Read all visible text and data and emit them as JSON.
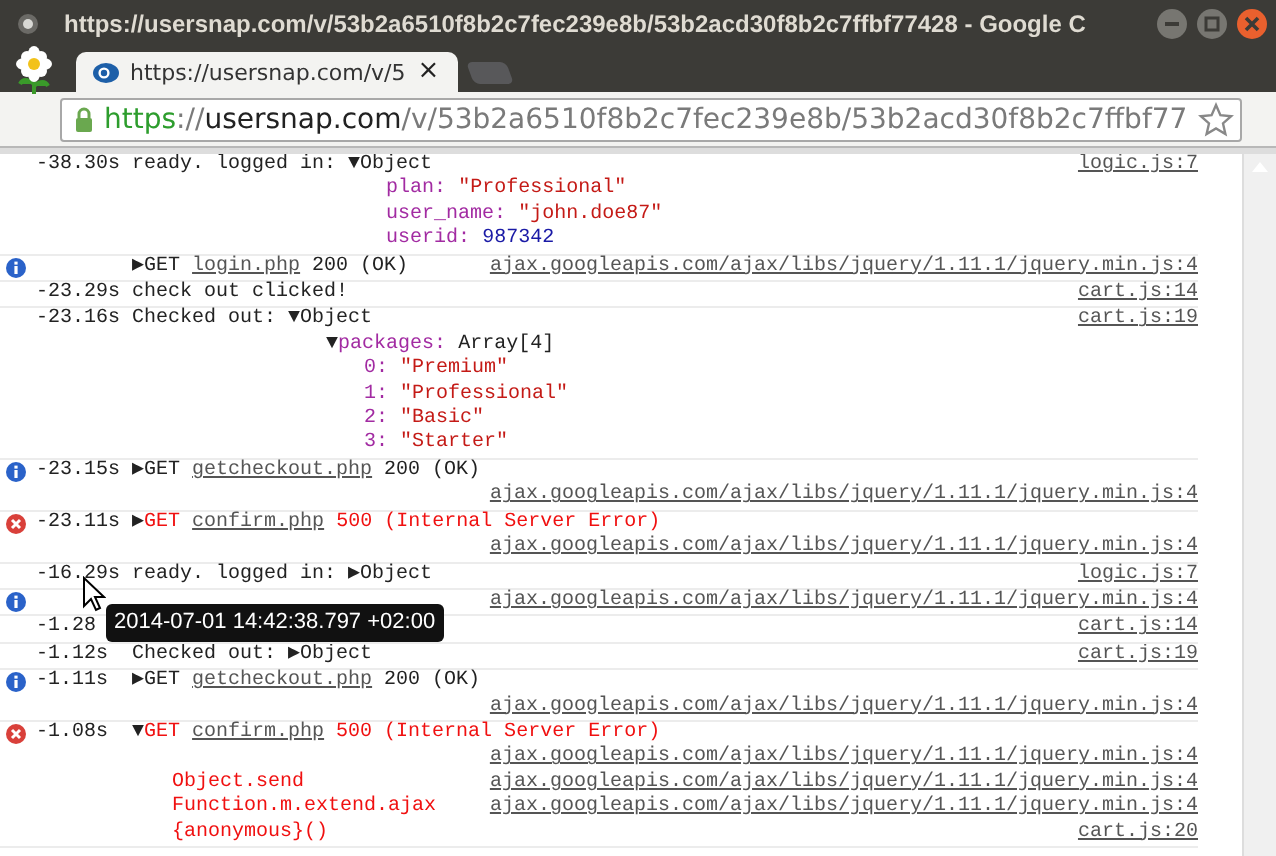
{
  "window": {
    "title": "https://usersnap.com/v/53b2a6510f8b2c7fec239e8b/53b2acd30f8b2c7ffbf77428 - Google C"
  },
  "tabs": [
    {
      "title": "https://usersnap.com/v/5",
      "selected": true,
      "close": "×"
    }
  ],
  "address_bar": [
    {
      "text": "https",
      "kind": "secure"
    },
    {
      "text": "://",
      "kind": "dim"
    },
    {
      "text": "usersnap.com",
      "kind": "host"
    },
    {
      "text": "/v/53b2a6510f8b2c7fec239e8b/53b2acd30f8b2c7ffbf77",
      "kind": "dim"
    }
  ],
  "console": [
    {
      "kind": "log",
      "time": "-38.30s",
      "message": [
        {
          "text": "ready. logged in: ",
          "kind": "plain"
        }
      ],
      "tree": {
        "toggle": "▼",
        "label": "Object",
        "children": [
          {
            "key": "plan:",
            "value": "\"Professional\"",
            "kind": "string"
          },
          {
            "key": "user_name:",
            "value": "\"john.doe87\"",
            "kind": "string"
          },
          {
            "key": "userid:",
            "value": "987342",
            "kind": "number"
          }
        ]
      },
      "source": "logic.js:7",
      "source_below": false
    },
    {
      "kind": "info",
      "message": [
        {
          "text": "▶GET ",
          "kind": "plain"
        },
        {
          "text": "login.php",
          "kind": "link"
        },
        {
          "text": " 200 (OK)",
          "kind": "plain"
        }
      ],
      "source": "ajax.googleapis.com/ajax/libs/jquery/1.11.1/jquery.min.js:4",
      "source_below": false
    },
    {
      "kind": "log",
      "time": "-23.29s",
      "message": [
        {
          "text": "check out clicked!",
          "kind": "plain"
        }
      ],
      "source": "cart.js:14",
      "source_below": false
    },
    {
      "kind": "log",
      "time": "-23.16s",
      "message": [
        {
          "text": "Checked out: ",
          "kind": "plain"
        }
      ],
      "tree": {
        "toggle": "▼",
        "label": "Object",
        "children": [
          {
            "toggle": "▼",
            "key": "packages:",
            "value": "Array[4]",
            "kind": "plain",
            "children": [
              {
                "key": "0:",
                "value": "\"Premium\"",
                "kind": "string"
              },
              {
                "key": "1:",
                "value": "\"Professional\"",
                "kind": "string"
              },
              {
                "key": "2:",
                "value": "\"Basic\"",
                "kind": "string"
              },
              {
                "key": "3:",
                "value": "\"Starter\"",
                "kind": "string"
              }
            ]
          }
        ]
      },
      "source": "cart.js:19",
      "source_below": false
    },
    {
      "kind": "info",
      "time": "-23.15s",
      "message": [
        {
          "text": "▶GET ",
          "kind": "plain"
        },
        {
          "text": "getcheckout.php",
          "kind": "link"
        },
        {
          "text": " 200 (OK)",
          "kind": "plain"
        }
      ],
      "source": "ajax.googleapis.com/ajax/libs/jquery/1.11.1/jquery.min.js:4",
      "source_below": true
    },
    {
      "kind": "error",
      "time": "-23.11s",
      "message": [
        {
          "text": "▶",
          "kind": "plain"
        },
        {
          "text": "GET ",
          "kind": "error"
        },
        {
          "text": "confirm.php",
          "kind": "link"
        },
        {
          "text": " 500 (Internal Server Error)",
          "kind": "error"
        }
      ],
      "source": "ajax.googleapis.com/ajax/libs/jquery/1.11.1/jquery.min.js:4",
      "source_below": true
    },
    {
      "kind": "log",
      "time": "-16.29s",
      "message": [
        {
          "text": "ready. logged in: ",
          "kind": "plain"
        }
      ],
      "tree": {
        "toggle": "▶",
        "label": "Object"
      },
      "source": "logic.js:7",
      "source_below": false
    },
    {
      "kind": "info",
      "source": "ajax.googleapis.com/ajax/libs/jquery/1.11.1/jquery.min.js:4",
      "source_below": false
    },
    {
      "kind": "log",
      "time": "-1.28",
      "source": "cart.js:14",
      "source_below": false,
      "tooltip": {
        "text": "2014-07-01 14:42:38.797 +02:00"
      }
    },
    {
      "kind": "log",
      "time": "-1.12s",
      "message": [
        {
          "text": "Checked out: ",
          "kind": "plain"
        }
      ],
      "tree": {
        "toggle": "▶",
        "label": "Object"
      },
      "source": "cart.js:19",
      "source_below": false
    },
    {
      "kind": "info",
      "time": "-1.11s",
      "message": [
        {
          "text": "▶GET ",
          "kind": "plain"
        },
        {
          "text": "getcheckout.php",
          "kind": "link"
        },
        {
          "text": " 200 (OK)",
          "kind": "plain"
        }
      ],
      "source": "ajax.googleapis.com/ajax/libs/jquery/1.11.1/jquery.min.js:4",
      "source_below": true
    },
    {
      "kind": "error",
      "time": "-1.08s",
      "message": [
        {
          "text": "▼",
          "kind": "plain"
        },
        {
          "text": "GET ",
          "kind": "error"
        },
        {
          "text": "confirm.php",
          "kind": "link"
        },
        {
          "text": " 500 (Internal Server Error)",
          "kind": "error"
        }
      ],
      "source": "ajax.googleapis.com/ajax/libs/jquery/1.11.1/jquery.min.js:4",
      "source_below": true,
      "trace": [
        {
          "fn": "Object.send",
          "source": "ajax.googleapis.com/ajax/libs/jquery/1.11.1/jquery.min.js:4"
        },
        {
          "fn": "Function.m.extend.ajax",
          "source": "ajax.googleapis.com/ajax/libs/jquery/1.11.1/jquery.min.js:4"
        },
        {
          "fn": "{anonymous}()",
          "source": "cart.js:20"
        }
      ]
    }
  ]
}
